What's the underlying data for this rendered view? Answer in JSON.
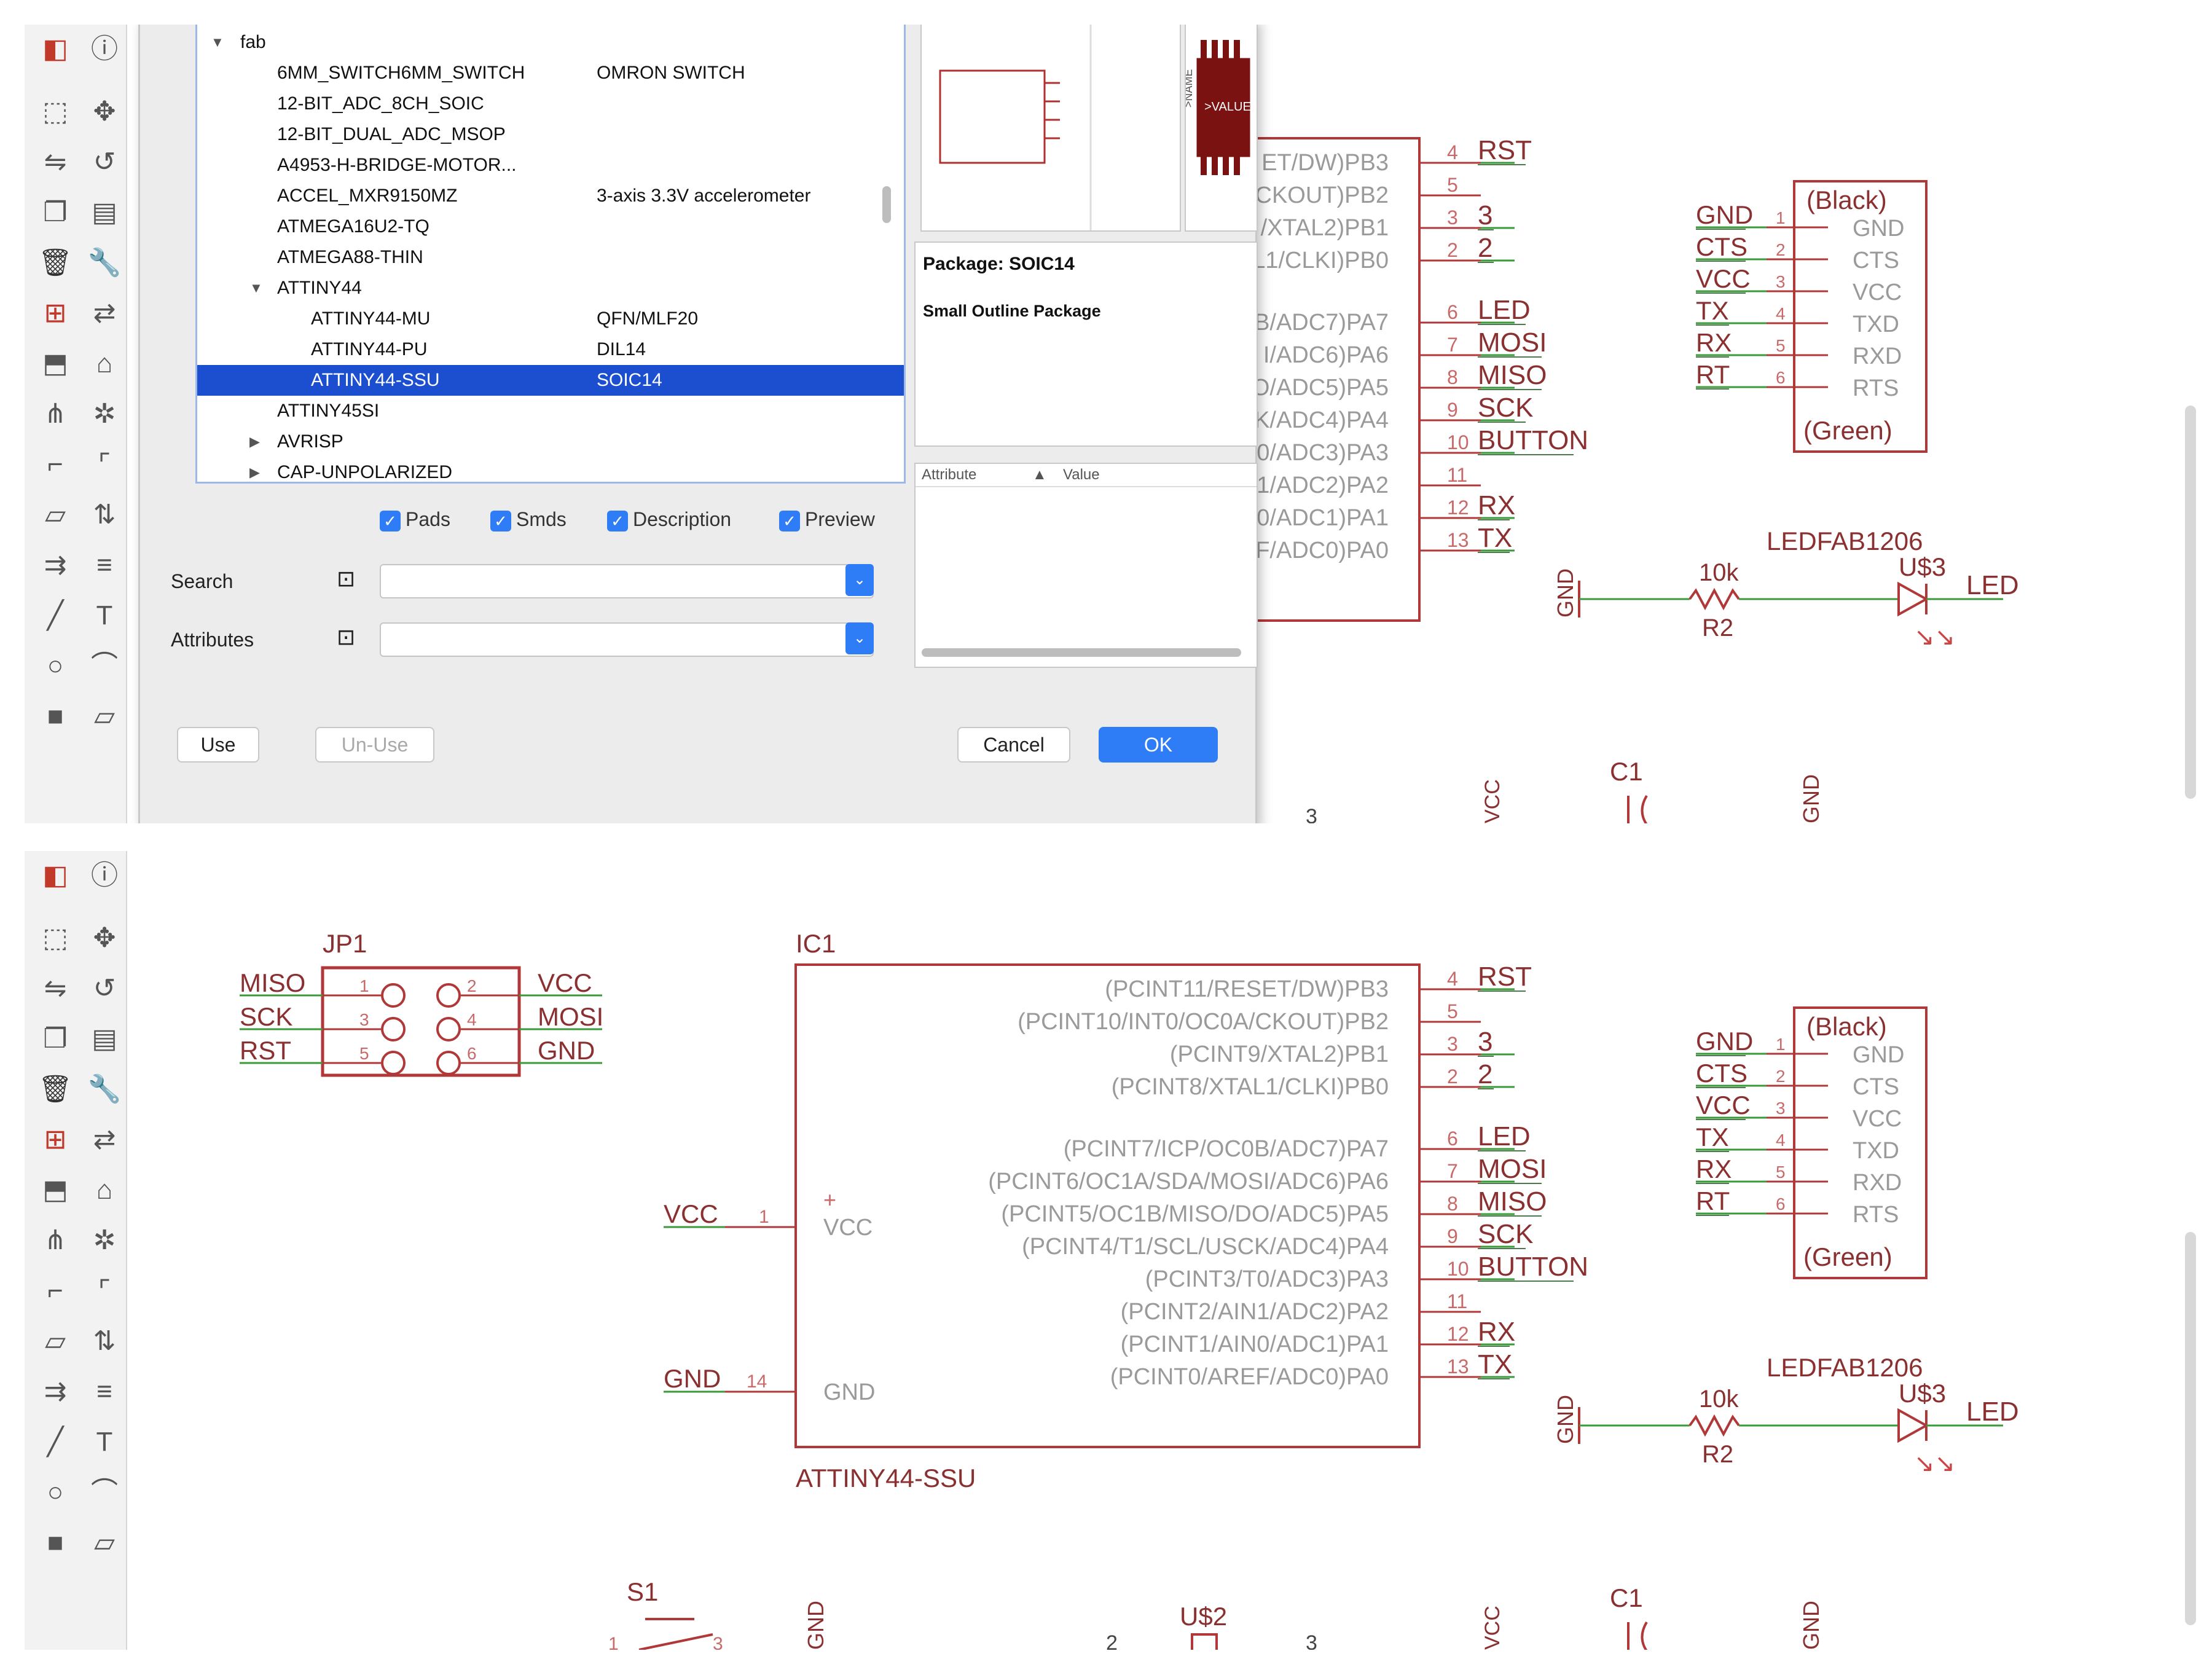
{
  "toolbar_icons": [
    "layers-icon",
    "info-icon",
    "select-icon",
    "move-icon",
    "mirror-icon",
    "rotate-icon",
    "copy-icon",
    "paste-icon",
    "delete-icon",
    "wrench-icon",
    "add-part-icon",
    "replace-icon",
    "group-icon",
    "value-icon",
    "split-icon",
    "smash-icon",
    "miter-icon",
    "bend-icon",
    "name-icon",
    "pin-swap-icon",
    "gate-swap-icon",
    "optimize-icon",
    "line-icon",
    "text-icon",
    "circle-icon",
    "arc-icon",
    "rect-icon",
    "polygon-icon"
  ],
  "dialog": {
    "tree_root": "fab",
    "items": [
      {
        "name": "6MM_SWITCH6MM_SWITCH",
        "desc": "OMRON SWITCH",
        "indent": 1
      },
      {
        "name": "12-BIT_ADC_8CH_SOIC",
        "desc": "",
        "indent": 1
      },
      {
        "name": "12-BIT_DUAL_ADC_MSOP",
        "desc": "",
        "indent": 1
      },
      {
        "name": "A4953-H-BRIDGE-MOTOR...",
        "desc": "",
        "indent": 1
      },
      {
        "name": "ACCEL_MXR9150MZ",
        "desc": "3-axis 3.3V accelerometer",
        "indent": 1
      },
      {
        "name": "ATMEGA16U2-TQ",
        "desc": "",
        "indent": 1
      },
      {
        "name": "ATMEGA88-THIN",
        "desc": "",
        "indent": 1
      },
      {
        "name": "ATTINY44",
        "desc": "",
        "indent": 1,
        "expanded": true
      },
      {
        "name": "ATTINY44-MU",
        "desc": "QFN/MLF20",
        "indent": 2
      },
      {
        "name": "ATTINY44-PU",
        "desc": "DIL14",
        "indent": 2
      },
      {
        "name": "ATTINY44-SSU",
        "desc": "SOIC14",
        "indent": 2,
        "selected": true
      },
      {
        "name": "ATTINY45SI",
        "desc": "",
        "indent": 1
      },
      {
        "name": "AVRISP",
        "desc": "",
        "indent": 1,
        "collapsed": true
      },
      {
        "name": "CAP-UNPOLARIZED",
        "desc": "",
        "indent": 1,
        "collapsed": true
      }
    ],
    "checkboxes": [
      "Pads",
      "Smds",
      "Description",
      "Preview"
    ],
    "search_label": "Search",
    "attributes_label": "Attributes",
    "use_label": "Use",
    "unuse_label": "Un-Use",
    "cancel_label": "Cancel",
    "ok_label": "OK",
    "package_line": "Package: SOIC14",
    "package_desc": "Small Outline Package",
    "attr_col1": "Attribute",
    "attr_sort": "▲",
    "attr_col2": "Value",
    "symbol_name": ">NAME",
    "symbol_value": ">VALUE"
  },
  "schematic": {
    "jp1": {
      "name": "JP1",
      "left_pins": [
        {
          "label": "MISO",
          "num": "1"
        },
        {
          "label": "SCK",
          "num": "3"
        },
        {
          "label": "RST",
          "num": "5"
        }
      ],
      "right_pins": [
        {
          "label": "VCC",
          "num": "2"
        },
        {
          "label": "MOSI",
          "num": "4"
        },
        {
          "label": "GND",
          "num": "6"
        }
      ]
    },
    "ic1": {
      "name": "IC1",
      "value": "ATTINY44-SSU",
      "right_pins": [
        {
          "fn": "(PCINT11/RESET/DW)PB3",
          "num": "4",
          "net": "RST"
        },
        {
          "fn": "(PCINT10/INT0/OC0A/CKOUT)PB2",
          "num": "5",
          "net": ""
        },
        {
          "fn": "(PCINT9/XTAL2)PB1",
          "num": "3",
          "net": "3"
        },
        {
          "fn": "(PCINT8/XTAL1/CLKI)PB0",
          "num": "2",
          "net": "2"
        },
        {
          "fn": "(PCINT7/ICP/OC0B/ADC7)PA7",
          "num": "6",
          "net": "LED"
        },
        {
          "fn": "(PCINT6/OC1A/SDA/MOSI/ADC6)PA6",
          "num": "7",
          "net": "MOSI"
        },
        {
          "fn": "(PCINT5/OC1B/MISO/DO/ADC5)PA5",
          "num": "8",
          "net": "MISO"
        },
        {
          "fn": "(PCINT4/T1/SCL/USCK/ADC4)PA4",
          "num": "9",
          "net": "SCK"
        },
        {
          "fn": "(PCINT3/T0/ADC3)PA3",
          "num": "10",
          "net": "BUTTON"
        },
        {
          "fn": "(PCINT2/AIN1/ADC2)PA2",
          "num": "11",
          "net": ""
        },
        {
          "fn": "(PCINT1/AIN0/ADC1)PA1",
          "num": "12",
          "net": "RX"
        },
        {
          "fn": "(PCINT0/AREF/ADC0)PA0",
          "num": "13",
          "net": "TX"
        }
      ],
      "vcc_net": "VCC",
      "vcc_num": "1",
      "vcc_pin": "VCC",
      "plus": "+",
      "gnd_net": "GND",
      "gnd_num": "14",
      "gnd_pin": "GND"
    },
    "dialog_clip_pins": [
      {
        "fn": "ET/DW)PB3",
        "num": "4",
        "net": "RST"
      },
      {
        "fn": "CKOUT)PB2",
        "num": "5",
        "net": ""
      },
      {
        "fn": "/XTAL2)PB1",
        "num": "3",
        "net": "3"
      },
      {
        "fn": "L1/CLKI)PB0",
        "num": "2",
        "net": "2"
      },
      {
        "fn": "B/ADC7)PA7",
        "num": "6",
        "net": "LED"
      },
      {
        "fn": "I/ADC6)PA6",
        "num": "7",
        "net": "MOSI"
      },
      {
        "fn": "O/ADC5)PA5",
        "num": "8",
        "net": "MISO"
      },
      {
        "fn": "K/ADC4)PA4",
        "num": "9",
        "net": "SCK"
      },
      {
        "fn": "T0/ADC3)PA3",
        "num": "10",
        "net": "BUTTON"
      },
      {
        "fn": "1/ADC2)PA2",
        "num": "11",
        "net": ""
      },
      {
        "fn": "0/ADC1)PA1",
        "num": "12",
        "net": "RX"
      },
      {
        "fn": "F/ADC0)PA0",
        "num": "13",
        "net": "TX"
      }
    ],
    "ftdi": {
      "top": "(Black)",
      "bottom": "(Green)",
      "pins": [
        {
          "net": "GND",
          "num": "1",
          "label": "GND"
        },
        {
          "net": "CTS",
          "num": "2",
          "label": "CTS"
        },
        {
          "net": "VCC",
          "num": "3",
          "label": "VCC"
        },
        {
          "net": "TX",
          "num": "4",
          "label": "TXD"
        },
        {
          "net": "RX",
          "num": "5",
          "label": "RXD"
        },
        {
          "net": "RT",
          "num": "6",
          "label": "RTS"
        }
      ]
    },
    "led_circuit": {
      "gnd": "GND",
      "res_value": "10k",
      "res_name": "R2",
      "led_name": "LEDFAB1206",
      "led_ref": "U$3",
      "net": "LED"
    },
    "bottom": {
      "s1": "S1",
      "us2": "U$2",
      "c1": "C1",
      "n1": "1",
      "n2": "2",
      "n3": "3"
    }
  }
}
